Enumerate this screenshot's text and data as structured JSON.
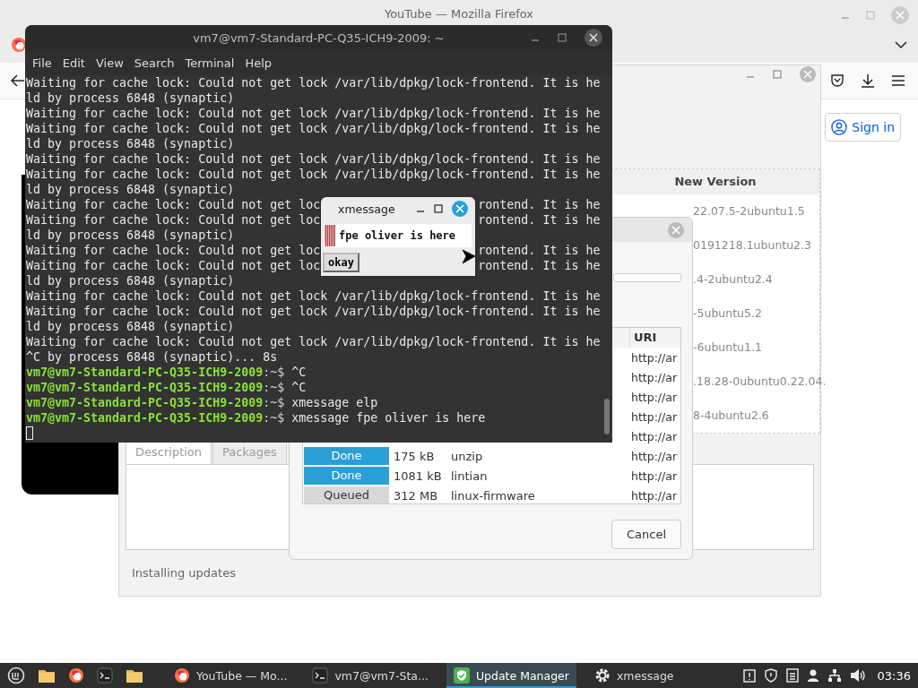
{
  "firefox": {
    "title": "YouTube — Mozilla Firefox",
    "sign_in": "Sign in"
  },
  "update_manager": {
    "list_header": "New Version",
    "versions": [
      "22.07.5-2ubuntu1.5",
      "0191218.1ubuntu2.3",
      ".4-2ubuntu2.4",
      "-5ubuntu5.2",
      "-6ubuntu1.1",
      ".18.28-0ubuntu0.22.04.",
      "8-4ubuntu2.6"
    ],
    "tabs": [
      {
        "label": "Description",
        "selected": true
      },
      {
        "label": "Packages",
        "selected": false
      }
    ],
    "status": "Installing updates"
  },
  "progress_dialog": {
    "level": 0,
    "columns": [
      {
        "label": "URI"
      }
    ],
    "rows": [
      {
        "uri": "http://ar"
      },
      {
        "uri": "http://ar"
      },
      {
        "uri": "http://ar"
      },
      {
        "uri": "http://ar"
      },
      {
        "uri": "http://ar"
      },
      {
        "status": "Done",
        "complete": true,
        "size": "175 kB",
        "name": "unzip",
        "uri": "http://ar"
      },
      {
        "status": "Done",
        "complete": true,
        "size": "1081 kB",
        "name": "lintian",
        "uri": "http://ar"
      },
      {
        "status": "Queued",
        "complete": false,
        "size": "312 MB",
        "name": "linux-firmware",
        "uri": "http://ar"
      }
    ],
    "cancel": "Cancel"
  },
  "terminal": {
    "title": "vm7@vm7-Standard-PC-Q35-ICH9-2009: ~",
    "menu": [
      "File",
      "Edit",
      "View",
      "Search",
      "Terminal",
      "Help"
    ],
    "lines": [
      {
        "kind": "output",
        "text": "Waiting for cache lock: Could not get lock /var/lib/dpkg/lock-frontend. It is he"
      },
      {
        "kind": "output",
        "text": "ld by process 6848 (synaptic)"
      },
      {
        "kind": "output",
        "text": "Waiting for cache lock: Could not get lock /var/lib/dpkg/lock-frontend. It is he"
      },
      {
        "kind": "output",
        "text": "Waiting for cache lock: Could not get lock /var/lib/dpkg/lock-frontend. It is he"
      },
      {
        "kind": "output",
        "text": "ld by process 6848 (synaptic)"
      },
      {
        "kind": "output",
        "text": "Waiting for cache lock: Could not get lock /var/lib/dpkg/lock-frontend. It is he"
      },
      {
        "kind": "output",
        "text": "Waiting for cache lock: Could not get lock /var/lib/dpkg/lock-frontend. It is he"
      },
      {
        "kind": "output",
        "text": "ld by process 6848 (synaptic)"
      },
      {
        "kind": "output",
        "text": "Waiting for cache lock: Could not get loc",
        "tail": "rontend. It is he"
      },
      {
        "kind": "output",
        "text": "Waiting for cache lock: Could not get loc",
        "tail": "rontend. It is he"
      },
      {
        "kind": "output",
        "text": "ld by process 6848 (synaptic)"
      },
      {
        "kind": "output",
        "text": "Waiting for cache lock: Could not get loc",
        "tail": "rontend. It is he"
      },
      {
        "kind": "output",
        "text": "Waiting for cache lock: Could not get loc",
        "tail": "rontend. It is he"
      },
      {
        "kind": "output",
        "text": "ld by process 6848 (synaptic)"
      },
      {
        "kind": "output",
        "text": "Waiting for cache lock: Could not get lock /var/lib/dpkg/lock-frontend. It is he"
      },
      {
        "kind": "output",
        "text": "Waiting for cache lock: Could not get lock /var/lib/dpkg/lock-frontend. It is he"
      },
      {
        "kind": "output",
        "text": "ld by process 6848 (synaptic)"
      },
      {
        "kind": "output",
        "text": "Waiting for cache lock: Could not get lock /var/lib/dpkg/lock-frontend. It is he"
      },
      {
        "kind": "output",
        "text": "^C by process 6848 (synaptic)... 8s"
      },
      {
        "kind": "prompt",
        "user": "vm7@vm7-Standard-PC-Q35-ICH9-2009",
        "path": ":~$",
        "command": "^C"
      },
      {
        "kind": "prompt",
        "user": "vm7@vm7-Standard-PC-Q35-ICH9-2009",
        "path": ":~$",
        "command": "^C"
      },
      {
        "kind": "prompt",
        "user": "vm7@vm7-Standard-PC-Q35-ICH9-2009",
        "path": ":~$",
        "command": "xmessage elp"
      },
      {
        "kind": "prompt",
        "user": "vm7@vm7-Standard-PC-Q35-ICH9-2009",
        "path": ":~$",
        "command": "xmessage fpe oliver is here"
      },
      {
        "kind": "cursor"
      }
    ]
  },
  "xmessage": {
    "title": "xmessage",
    "message": "fpe oliver is here",
    "button": "okay"
  },
  "taskbar": {
    "tasks": [
      {
        "kind": "browser",
        "label": "YouTube — Mo...",
        "selected": false
      },
      {
        "kind": "terminal",
        "label": "vm7@vm7-Sta...",
        "selected": false
      },
      {
        "kind": "updater",
        "label": "Update Manager",
        "selected": true
      },
      {
        "kind": "settings",
        "label": "xmessage",
        "selected": false
      }
    ],
    "clock": "03:36"
  }
}
